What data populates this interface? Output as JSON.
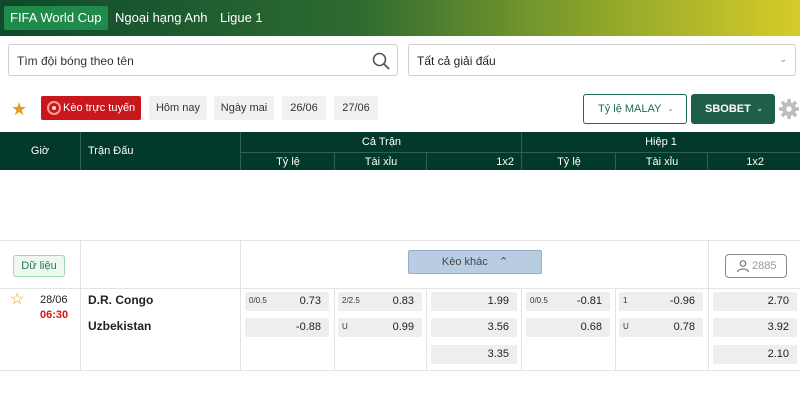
{
  "leagues": [
    "FIFA World Cup",
    "Ngoại hạng Anh",
    "Ligue 1"
  ],
  "search": {
    "text": "Tìm đội bóng theo tên"
  },
  "league_select": {
    "text": "Tất cả giải đấu"
  },
  "filters": {
    "live": "Kèo trực tuyến",
    "dates": [
      "Hôm nay",
      "Ngày mai",
      "26/06",
      "27/06"
    ],
    "odds_type": "Tỷ lệ MALAY",
    "bookmaker": "SBOBET"
  },
  "table": {
    "col_time": "Giờ",
    "col_match": "Trận Đấu",
    "group_full": "Cả Trận",
    "group_half": "Hiệp 1",
    "sub_cols": [
      "Tỷ lệ",
      "Tài xỉu",
      "1x2",
      "Tỷ lệ",
      "Tài xỉu",
      "1x2"
    ]
  },
  "actions": {
    "data_label": "Dữ liệu",
    "more_label": "Kèo khác",
    "count": "2885"
  },
  "match": {
    "date": "28/06",
    "time": "06:30",
    "home": "D.R. Congo",
    "away": "Uzbekistan",
    "full": {
      "handicap": [
        {
          "line": "0/0.5",
          "odds": "0.73"
        },
        {
          "line": "",
          "odds": "-0.88"
        }
      ],
      "overunder": [
        {
          "line": "2/2.5",
          "odds": "0.83"
        },
        {
          "line": "U",
          "odds": "0.99"
        }
      ],
      "x12": [
        "1.99",
        "3.56",
        "3.35"
      ]
    },
    "half": {
      "handicap": [
        {
          "line": "0/0.5",
          "odds": "-0.81"
        },
        {
          "line": "",
          "odds": "0.68"
        }
      ],
      "overunder": [
        {
          "line": "1",
          "odds": "-0.96"
        },
        {
          "line": "U",
          "odds": "0.78"
        }
      ],
      "x12": [
        "2.70",
        "3.92",
        "2.10"
      ]
    }
  },
  "colors": {
    "header_bg": "#03392b",
    "live_red": "#c8181d",
    "accent_green": "#1f5e48",
    "star": "#e79b1a"
  }
}
